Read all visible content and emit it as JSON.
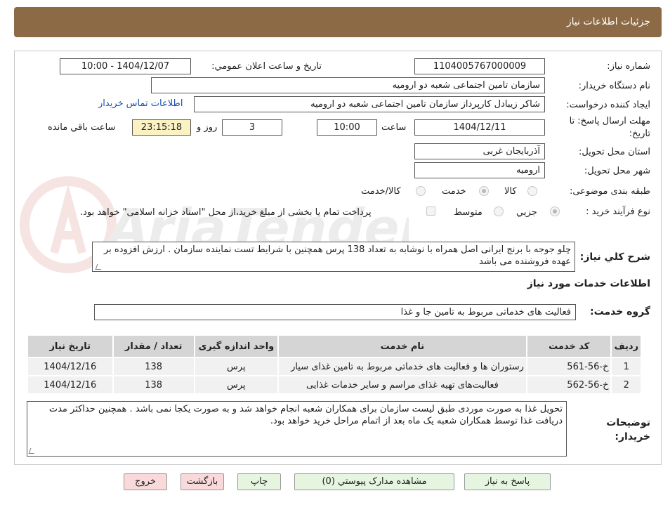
{
  "header": {
    "title": "جزئیات اطلاعات نیاز"
  },
  "form": {
    "need_number_label": "شماره نیاز:",
    "need_number": "1104005767000009",
    "announce_label": "تاریخ و ساعت اعلان عمومي:",
    "announce_value": "1404/12/07 - 10:00",
    "buyer_org_label": "نام دستگاه خريدار:",
    "buyer_org": "سازمان تامین اجتماعی شعبه دو ارومیه",
    "creator_label": "ايجاد کننده درخواست:",
    "creator": "شاکر زیبادل کارپرداز سازمان تامین اجتماعی شعبه دو ارومیه",
    "contact_link": "اطلاعات تماس خريدار",
    "deadline_label": "مهلت ارسال پاسخ: تا تاریخ:",
    "deadline_date": "1404/12/11",
    "time_label": "ساعت",
    "deadline_time": "10:00",
    "days_value": "3",
    "days_label": "روز و",
    "remaining_time": "23:15:18",
    "remaining_label": "ساعت باقي مانده",
    "province_label": "استان محل تحویل:",
    "province": "آذربایجان غربی",
    "city_label": "شهر محل تحویل:",
    "city": "ارومیه",
    "category_label": "طبقه بندی موضوعی:",
    "category_options": [
      "کالا",
      "خدمت",
      "کالا/خدمت"
    ],
    "process_label": "نوع فرآیند خرید :",
    "process_options": [
      "جزيي",
      "متوسط"
    ],
    "payment_note": "پرداخت تمام یا بخشی از مبلغ خرید،از محل \"اسناد خزانه اسلامی\" خواهد بود.",
    "description_label": "شرح كلي نياز:",
    "description": "چلو جوجه با برنج ایرانی اصل همراه با نوشابه به تعداد 138 پرس همچنین با شرایط تست نماینده سازمان . ارزش افزوده بر عهده فروشنده می باشد",
    "services_section": "اطلاعات خدمات مورد نياز",
    "service_group_label": "گروه خدمت:",
    "service_group": "فعالیت های خدماتی مربوط به تامین جا و غذا",
    "buyer_notes_label": "توضیحات خریدار:",
    "buyer_notes": "تحویل غذا به صورت موردی طبق لیست سازمان برای همکاران شعبه انجام خواهد شد و به صورت یکجا نمی باشد . همچنین حداکثر مدت دریافت غذا توسط همکاران شعبه یک ماه بعد از اتمام مراحل خرید خواهد بود."
  },
  "table": {
    "headers": [
      "رديف",
      "کد خدمت",
      "نام خدمت",
      "واحد اندازه گیری",
      "تعداد / مقدار",
      "تاریخ نیاز"
    ],
    "rows": [
      [
        "1",
        "خ-56-561",
        "رستوران ها و فعالیت های خدماتی مربوط به تامین غذای سیار",
        "پرس",
        "138",
        "1404/12/16"
      ],
      [
        "2",
        "خ-56-562",
        "فعالیت‌های تهیه غذای مراسم و سایر خدمات غذایی",
        "پرس",
        "138",
        "1404/12/16"
      ]
    ]
  },
  "buttons": {
    "reply": "پاسخ به نياز",
    "attachments": "مشاهده مدارک پیوستي (0)",
    "print": "چاپ",
    "back": "بازگشت",
    "exit": "خروج"
  },
  "watermark_text": "AriaTender.neT",
  "colors": {
    "header_bg": "#8b6a45",
    "link": "#1a4fb5",
    "green_button": "#e5f5e0",
    "pink_button": "#f9d9d9",
    "remaining_bg": "#fbf2c4"
  }
}
